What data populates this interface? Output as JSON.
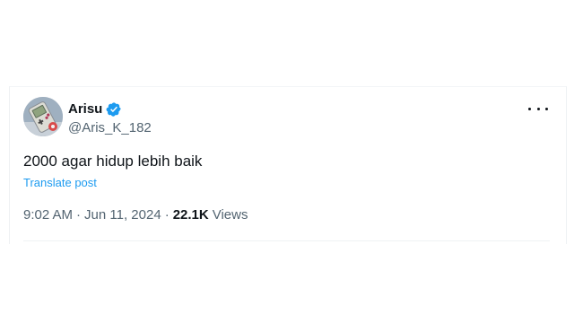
{
  "post": {
    "author": {
      "display_name": "Arisu",
      "handle": "@Aris_K_182",
      "verified": true,
      "avatar_icon": "handheld-console-avatar"
    },
    "more_icon": "more-horizontal-icon",
    "text": "2000 agar hidup lebih baik",
    "translate_label": "Translate post",
    "time": "9:02 AM",
    "separator": "·",
    "date": "Jun 11, 2024",
    "views_count": "22.1K",
    "views_label": "Views"
  },
  "colors": {
    "verified": "#1d9bf0",
    "link": "#1d9bf0",
    "muted": "#536471",
    "text": "#0f1419"
  }
}
